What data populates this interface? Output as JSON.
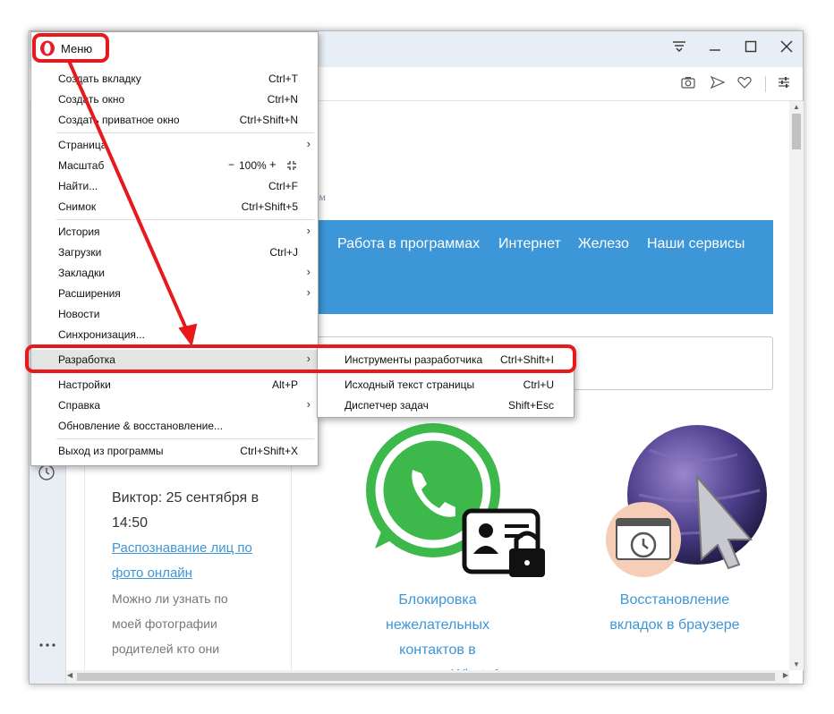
{
  "menu": {
    "title": "Меню",
    "items": [
      {
        "label": "Создать вкладку",
        "shortcut": "Ctrl+T"
      },
      {
        "label": "Создать окно",
        "shortcut": "Ctrl+N"
      },
      {
        "label": "Создать приватное окно",
        "shortcut": "Ctrl+Shift+N"
      },
      {
        "label": "Страница",
        "shortcut": ""
      },
      {
        "label": "Масштаб",
        "shortcut": ""
      },
      {
        "label": "Найти...",
        "shortcut": "Ctrl+F"
      },
      {
        "label": "Снимок",
        "shortcut": "Ctrl+Shift+5"
      },
      {
        "label": "История",
        "shortcut": ""
      },
      {
        "label": "Загрузки",
        "shortcut": "Ctrl+J"
      },
      {
        "label": "Закладки",
        "shortcut": ""
      },
      {
        "label": "Расширения",
        "shortcut": ""
      },
      {
        "label": "Новости",
        "shortcut": ""
      },
      {
        "label": "Синхронизация...",
        "shortcut": ""
      },
      {
        "label": "Разработка",
        "shortcut": ""
      },
      {
        "label": "Настройки",
        "shortcut": "Alt+P"
      },
      {
        "label": "Справка",
        "shortcut": ""
      },
      {
        "label": "Обновление & восстановление...",
        "shortcut": ""
      },
      {
        "label": "Выход из программы",
        "shortcut": "Ctrl+Shift+X"
      }
    ],
    "zoom": {
      "minus": "−",
      "value": "100%",
      "plus": "+"
    }
  },
  "submenu": {
    "items": [
      {
        "label": "Инструменты разработчика",
        "shortcut": "Ctrl+Shift+I"
      },
      {
        "label": "Исходный текст страницы",
        "shortcut": "Ctrl+U"
      },
      {
        "label": "Диспетчер задач",
        "shortcut": "Shift+Esc"
      }
    ]
  },
  "page": {
    "faint_text": "ем",
    "nav": [
      "Работа в программах",
      "Интернет",
      "Железо",
      "Наши сервисы"
    ],
    "comment": {
      "author_line1": "Виктор: 25 сентября в",
      "author_line2": "14:50",
      "link_line1": "Распознавание лиц по",
      "link_line2": "фото онлайн",
      "text_line1": "Можно ли узнать по",
      "text_line2": "моей фотографии",
      "text_line3": "родителей кто они"
    },
    "article1": [
      "Блокировка",
      "нежелательных",
      "контактов в",
      "мессенджере WhatsApp"
    ],
    "article2": [
      "Восстановление",
      "вкладок в браузере"
    ]
  },
  "colors": {
    "accent": "#3d96d8",
    "annotation": "#e8191c",
    "titlebar": "#e7eef6"
  }
}
